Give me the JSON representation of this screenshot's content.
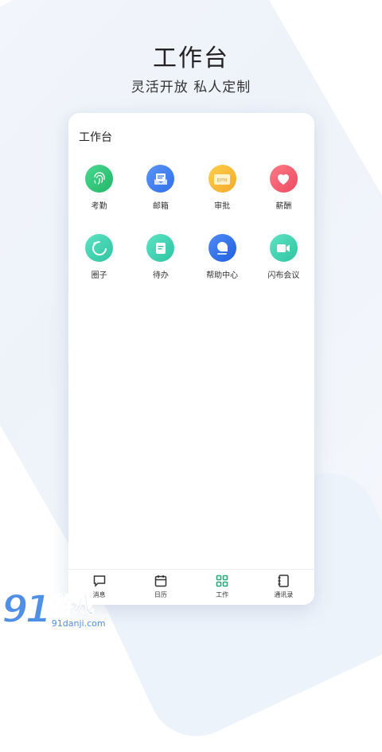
{
  "headline": "工作台",
  "subline": "灵活开放 私人定制",
  "screen": {
    "title": "工作台",
    "apps": [
      {
        "label": "考勤",
        "icon": "fingerprint-icon",
        "color": "#33c27a"
      },
      {
        "label": "邮箱",
        "icon": "mail-icon",
        "color": "#3f7ff0"
      },
      {
        "label": "审批",
        "icon": "approval-folder-icon",
        "color": "#f5b731"
      },
      {
        "label": "薪酬",
        "icon": "heart-icon",
        "color": "#f0566a"
      },
      {
        "label": "圈子",
        "icon": "circle-icon",
        "color": "#3fd1b0"
      },
      {
        "label": "待办",
        "icon": "todo-icon",
        "color": "#3fd1b0"
      },
      {
        "label": "帮助中心",
        "icon": "help-bubble-icon",
        "color": "#2f6fe8"
      },
      {
        "label": "闪布会议",
        "icon": "video-camera-icon",
        "color": "#3fd1b0"
      }
    ],
    "approval_icon_text": "BPM"
  },
  "tabbar": {
    "items": [
      {
        "label": "消息",
        "icon": "message-icon"
      },
      {
        "label": "日历",
        "icon": "calendar-icon"
      },
      {
        "label": "工作",
        "icon": "grid-icon",
        "active": true
      },
      {
        "label": "通讯录",
        "icon": "contacts-icon"
      }
    ],
    "active_color": "#2aa87a"
  },
  "watermark": {
    "number": "91",
    "text": "游戏",
    "url": "91danji.com"
  }
}
